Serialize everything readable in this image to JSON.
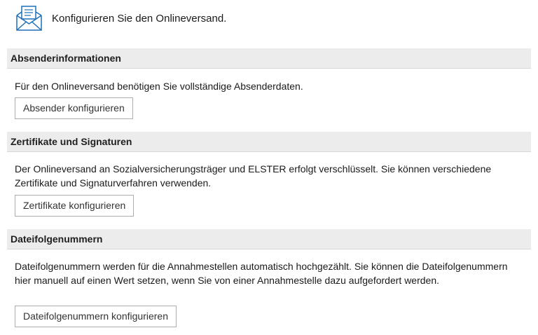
{
  "header": {
    "title": "Konfigurieren Sie den Onlineversand.",
    "icon": "envelope-icon",
    "icon_color": "#1e6fb8"
  },
  "sections": [
    {
      "heading": "Absenderinformationen",
      "text": "Für den Onlineversand benötigen Sie vollständige Absenderdaten.",
      "button_label": "Absender konfigurieren"
    },
    {
      "heading": "Zertifikate und Signaturen",
      "text": "Der Onlineversand an Sozialversicherungsträger und ELSTER erfolgt verschlüsselt. Sie können verschiedene Zertifikate und Signaturverfahren verwenden.",
      "button_label": "Zertifikate konfigurieren"
    },
    {
      "heading": "Dateifolgenummern",
      "text": "Dateifolgenummern werden für die Annahmestellen automatisch hochgezählt. Sie können die Dateifolgenummern hier manuell auf einen Wert setzen, wenn Sie von einer Annahmestelle dazu aufgefordert werden.",
      "button_label": "Dateifolgenummern konfigurieren"
    }
  ],
  "colors": {
    "section_header_bg": "#ececec",
    "button_border": "#adadad"
  }
}
